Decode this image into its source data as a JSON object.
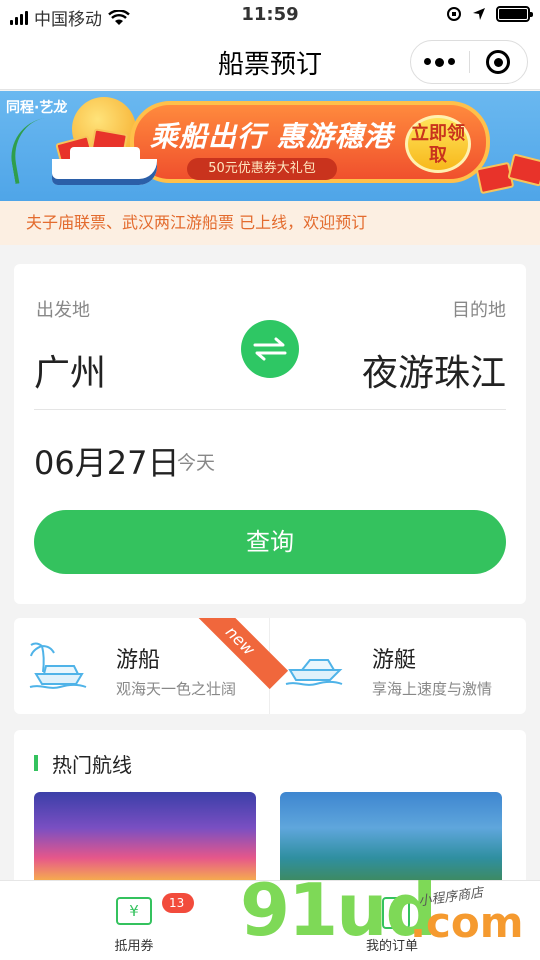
{
  "status_bar": {
    "carrier": "中国移动",
    "time": "11:59"
  },
  "nav": {
    "title": "船票预订"
  },
  "banner": {
    "brand": "同程·艺龙",
    "headline": "乘船出行 惠游穗港",
    "coupon_text": "50元优惠券大礼包",
    "claim_label": "立即领取"
  },
  "notice": {
    "text": "夫子庙联票、武汉两江游船票 已上线，欢迎预订"
  },
  "search": {
    "from_label": "出发地",
    "to_label": "目的地",
    "from_city": "广州",
    "to_city": "夜游珠江",
    "date": "06月27日",
    "date_note": "今天",
    "button_label": "查询"
  },
  "categories": [
    {
      "title": "游船",
      "subtitle": "观海天一色之壮阔",
      "badge": "new",
      "icon": "cruise-ship-icon"
    },
    {
      "title": "游艇",
      "subtitle": "享海上速度与激情",
      "icon": "yacht-icon"
    }
  ],
  "routes": {
    "title": "热门航线"
  },
  "tab_bar": {
    "coupon_label": "抵用券",
    "coupon_badge": "13张",
    "orders_label": "我的订单"
  },
  "watermark": {
    "text": "91ud",
    "suffix": ".com",
    "tagline": "小程序商店"
  },
  "colors": {
    "accent": "#34c25e",
    "notice_text": "#e36b2e",
    "notice_bg": "#fcefe2",
    "badge": "#f24b3c"
  }
}
